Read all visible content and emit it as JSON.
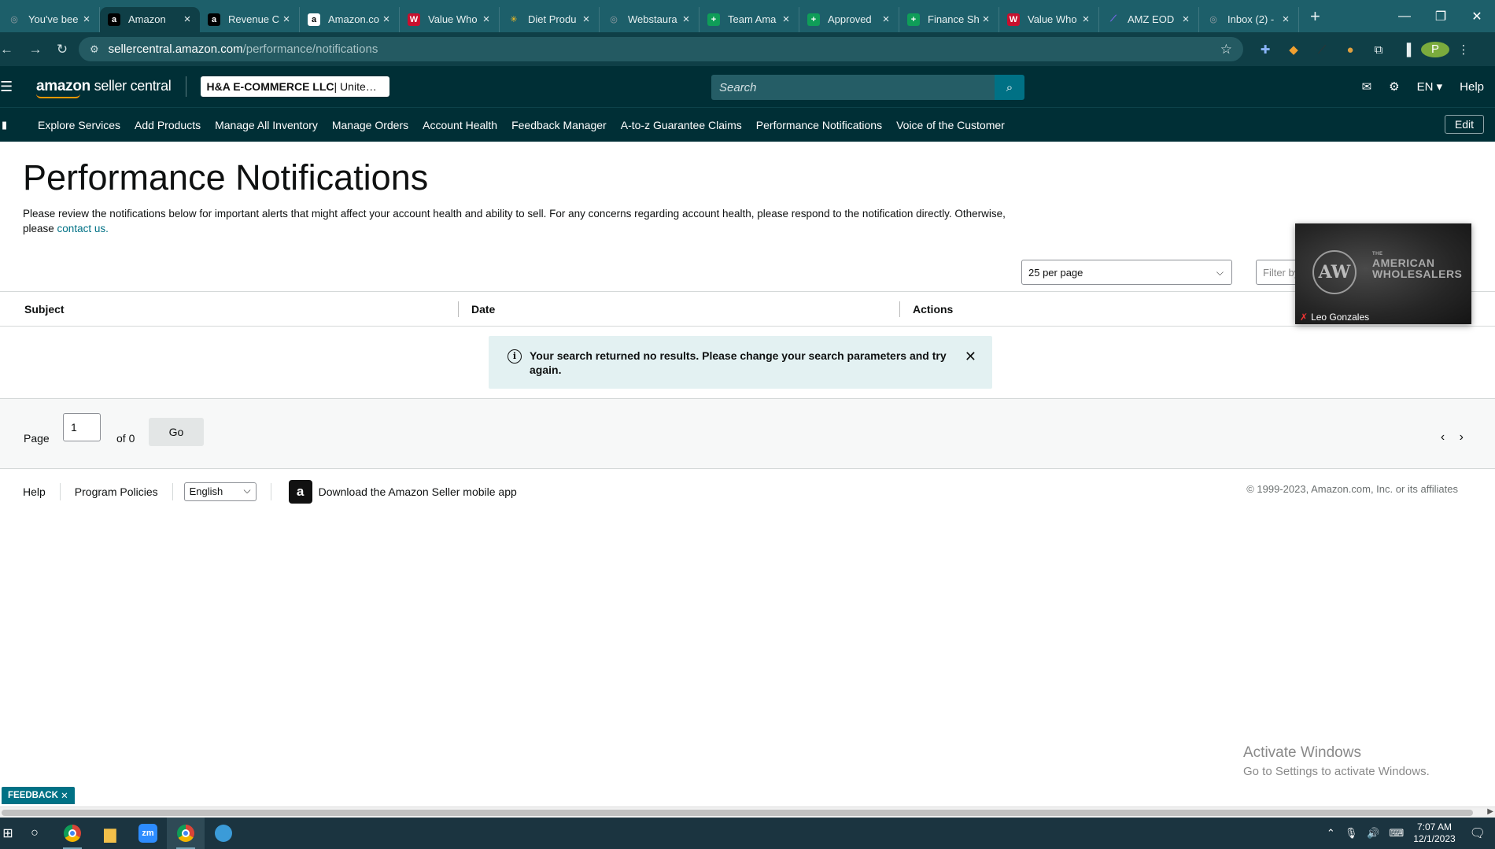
{
  "browser": {
    "tabs": [
      {
        "title": "You've bee",
        "icon": "globe-icon",
        "color": "#9aa0a6",
        "glyph": "◎"
      },
      {
        "title": "Amazon",
        "icon": "amazon-icon",
        "color": "#000000",
        "glyph": "a",
        "active": true
      },
      {
        "title": "Revenue C",
        "icon": "amazon-icon",
        "color": "#000000",
        "glyph": "a"
      },
      {
        "title": "Amazon.co",
        "icon": "amazon-icon",
        "color": "#ffffff",
        "glyph": "a"
      },
      {
        "title": "Value Who",
        "icon": "vw-icon",
        "color": "#c8102e",
        "glyph": "W"
      },
      {
        "title": "Diet Produ",
        "icon": "walmart-icon",
        "color": "#ffc220",
        "glyph": "✳"
      },
      {
        "title": "Webstaura",
        "icon": "globe-icon",
        "color": "#9aa0a6",
        "glyph": "◎"
      },
      {
        "title": "Team Ama",
        "icon": "sheets-icon",
        "color": "#0f9d58",
        "glyph": "+"
      },
      {
        "title": "Approved",
        "icon": "sheets-icon",
        "color": "#0f9d58",
        "glyph": "+"
      },
      {
        "title": "Finance Sh",
        "icon": "sheets-icon",
        "color": "#0f9d58",
        "glyph": "+"
      },
      {
        "title": "Value Who",
        "icon": "vw-icon",
        "color": "#c8102e",
        "glyph": "W"
      },
      {
        "title": "AMZ EOD",
        "icon": "clickup-icon",
        "color": "#7b68ee",
        "glyph": "⟋"
      },
      {
        "title": "Inbox (2) -",
        "icon": "globe-icon",
        "color": "#9aa0a6",
        "glyph": "◎"
      }
    ],
    "url_host": "sellercentral.amazon.com",
    "url_path": "/performance/notifications",
    "profile_initial": "P"
  },
  "header": {
    "logo_bold": "amazon",
    "logo_light": " seller central",
    "account_name": "H&A E-COMMERCE LLC",
    "account_region": " | Unite…",
    "search_placeholder": "Search",
    "lang": "EN ▾",
    "help": "Help"
  },
  "nav": {
    "links": [
      "Explore Services",
      "Add Products",
      "Manage All Inventory",
      "Manage Orders",
      "Account Health",
      "Feedback Manager",
      "A-to-z Guarantee Claims",
      "Performance Notifications",
      "Voice of the Customer"
    ],
    "edit": "Edit"
  },
  "main": {
    "title": "Performance Notifications",
    "intro_text": "Please review the notifications below for important alerts that might affect your account health and ability to sell. For any concerns regarding account health, please respond to the notification directly. Otherwise, please ",
    "intro_link": "contact us.",
    "per_page": "25 per page",
    "filter_placeholder": "Filter by",
    "columns": [
      "Subject",
      "Date",
      "Actions"
    ],
    "alert_message": "Your search returned no results. Please change your search parameters and try again."
  },
  "pager": {
    "page_label": "Page",
    "page_value": "1",
    "of_label": "of 0",
    "go_label": "Go"
  },
  "footer": {
    "help": "Help",
    "policies": "Program Policies",
    "language": "English",
    "app_text": "Download the Amazon Seller mobile app",
    "copyright": "© 1999-2023, Amazon.com, Inc. or its affiliates"
  },
  "video": {
    "logo_text": "AW",
    "brand_small": "THE",
    "brand_line1": "AMERICAN",
    "brand_line2": "WHOLESALERS",
    "participant": "Leo Gonzales"
  },
  "watermark": {
    "line1": "Activate Windows",
    "line2": "Go to Settings to activate Windows."
  },
  "feedback_label": "FEEDBACK",
  "taskbar": {
    "time": "7:07 AM",
    "date": "12/1/2023"
  }
}
